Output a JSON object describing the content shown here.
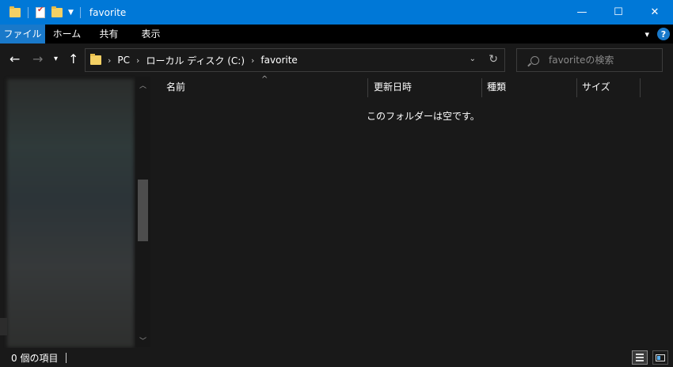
{
  "window": {
    "title": "favorite",
    "controls": {
      "minimize": "—",
      "maximize": "☐",
      "close": "✕"
    }
  },
  "ribbon": {
    "tabs": [
      {
        "label": "ファイル"
      },
      {
        "label": "ホーム"
      },
      {
        "label": "共有"
      },
      {
        "label": "表示"
      }
    ],
    "help": "?"
  },
  "navigation": {
    "breadcrumbs": [
      "PC",
      "ローカル ディスク (C:)",
      "favorite"
    ],
    "search_placeholder": "favoriteの検索"
  },
  "columns": [
    {
      "label": "名前"
    },
    {
      "label": "更新日時"
    },
    {
      "label": "種類"
    },
    {
      "label": "サイズ"
    }
  ],
  "content": {
    "empty_message": "このフォルダーは空です。"
  },
  "status": {
    "item_count": "0 個の項目"
  },
  "icons": {
    "back": "back-arrow-icon",
    "forward": "forward-arrow-icon",
    "up": "up-arrow-icon",
    "refresh": "refresh-icon",
    "search": "search-icon",
    "folder": "folder-icon",
    "help": "help-icon"
  },
  "colors": {
    "titlebar": "#0078d7",
    "file_tab": "#1979ca",
    "background": "#191919"
  }
}
